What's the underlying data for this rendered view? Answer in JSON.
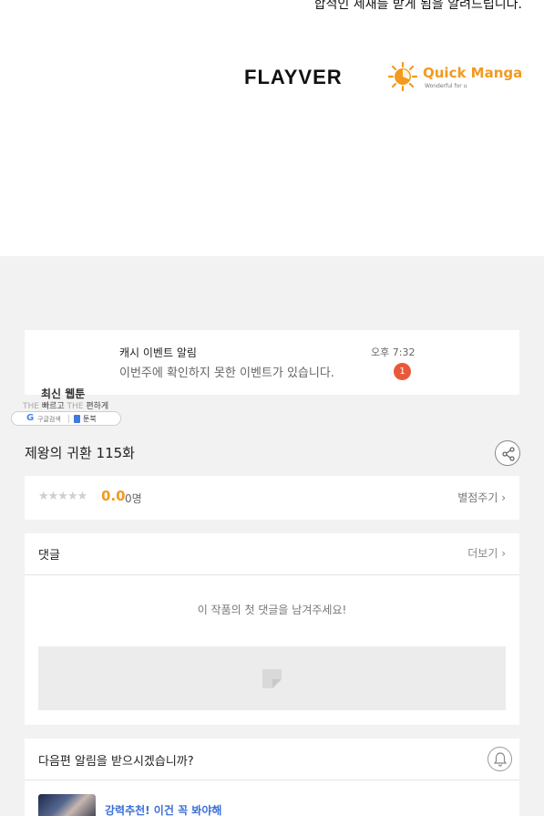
{
  "top": {
    "notice_text": "합적인 제재를 받게 됨을 알려드립니다.",
    "partners": [
      "FLAYVER",
      "Quick Manga"
    ],
    "quick_manga_sub": "Wonderful for u"
  },
  "notification": {
    "title": "캐시 이벤트 알림",
    "message": "이번주에 확인하지 못한 이벤트가 있습니다.",
    "time": "오후 7:32",
    "badge_count": "1"
  },
  "site_badge": {
    "title": "최신 웹툰",
    "line_prefix": "THE",
    "line_fast": "빠르고",
    "line_prefix2": "THE",
    "line_easy": "편하게",
    "google_label": "구글검색",
    "book_label": "툰북"
  },
  "episode": {
    "title": "제왕의 귀환 115화"
  },
  "rating": {
    "stars": "★★★★★",
    "score": "0.0",
    "count": "0명",
    "rate_label": "별점주기 ›"
  },
  "comments": {
    "heading": "댓글",
    "more_label": "더보기 ›",
    "empty_text": "이 작품의 첫 댓글을 남겨주세요!"
  },
  "next_episode": {
    "question": "다음편 알림을 받으시겠습니까?",
    "recommend_label": "강력추천! 이건 꼭 봐야해"
  },
  "colors": {
    "accent_orange": "#f29a1f",
    "badge_red": "#e8593a",
    "link_blue": "#3a6fd8",
    "page_bg": "#f2f2f2"
  }
}
